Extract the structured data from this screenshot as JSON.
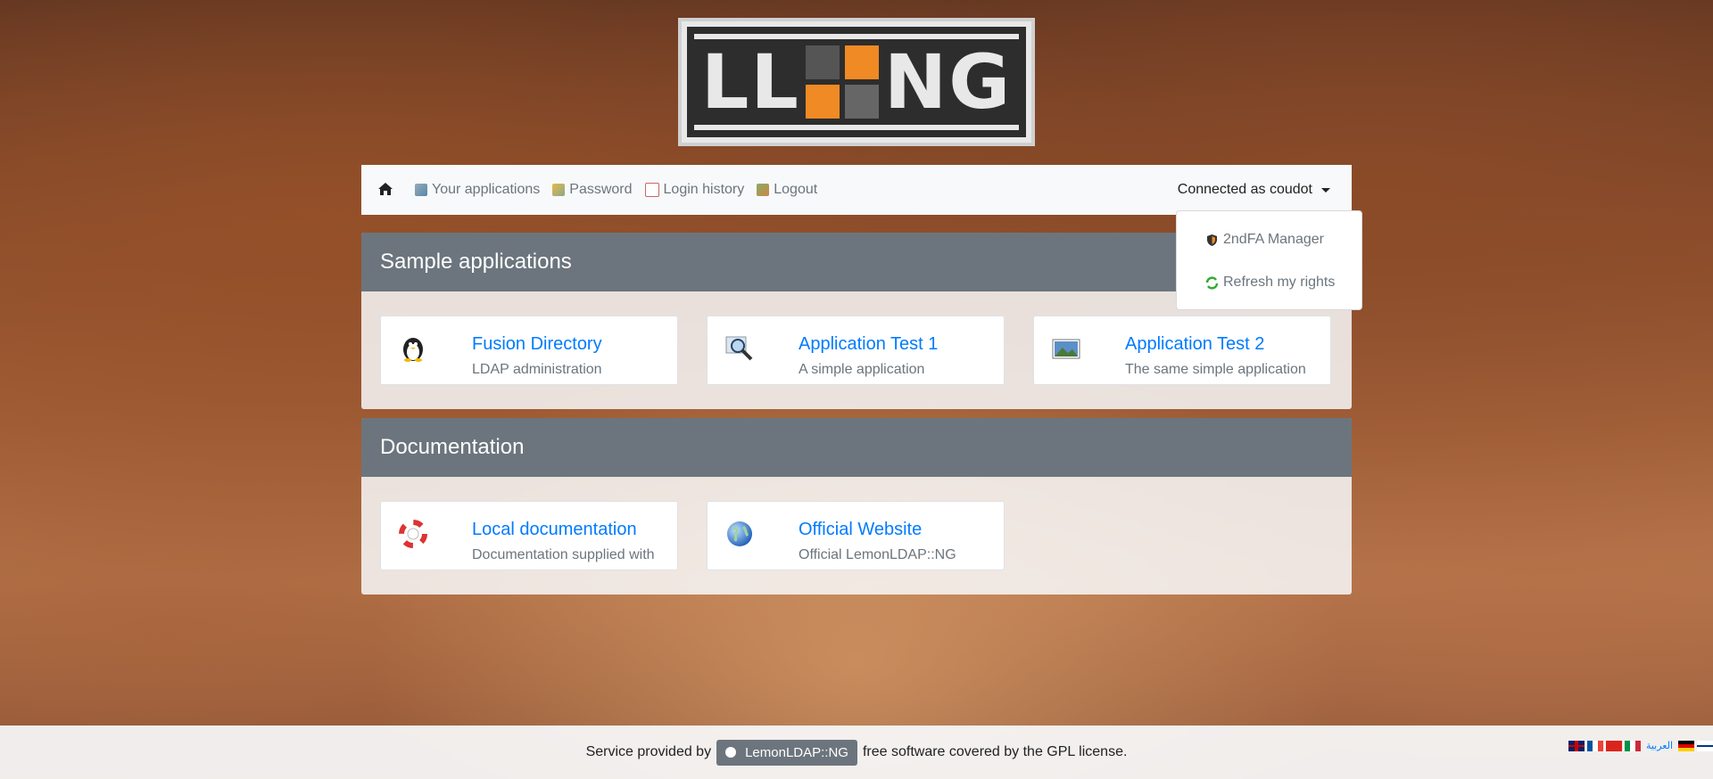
{
  "logo": {
    "text_left": "LL",
    "text_right": "NG"
  },
  "nav": {
    "items": [
      {
        "label": "Your applications",
        "icon": "apps-icon"
      },
      {
        "label": "Password",
        "icon": "key-icon"
      },
      {
        "label": "Login history",
        "icon": "calendar-icon"
      },
      {
        "label": "Logout",
        "icon": "logout-icon"
      }
    ],
    "user_label": "Connected as coudot"
  },
  "dropdown": {
    "items": [
      {
        "label": "2ndFA Manager",
        "icon": "shield-icon"
      },
      {
        "label": "Refresh my rights",
        "icon": "refresh-icon"
      }
    ]
  },
  "categories": [
    {
      "title": "Sample applications",
      "apps": [
        {
          "title": "Fusion Directory",
          "desc": "LDAP administration",
          "icon": "penguin-icon"
        },
        {
          "title": "Application Test 1",
          "desc": "A simple application",
          "icon": "magnifier-icon"
        },
        {
          "title": "Application Test 2",
          "desc": "The same simple application",
          "icon": "picture-icon"
        }
      ]
    },
    {
      "title": "Documentation",
      "apps": [
        {
          "title": "Local documentation",
          "desc": "Documentation supplied with",
          "icon": "lifebuoy-icon"
        },
        {
          "title": "Official Website",
          "desc": "Official LemonLDAP::NG",
          "icon": "globe-icon"
        }
      ]
    }
  ],
  "footer": {
    "prefix": "Service provided by",
    "badge": "LemonLDAP::NG",
    "suffix": "free software covered by the GPL license.",
    "language_text": "العربية"
  },
  "colors": {
    "accent": "#007bff",
    "panel_header": "#6c757d",
    "logo_orange": "#f08a24"
  }
}
